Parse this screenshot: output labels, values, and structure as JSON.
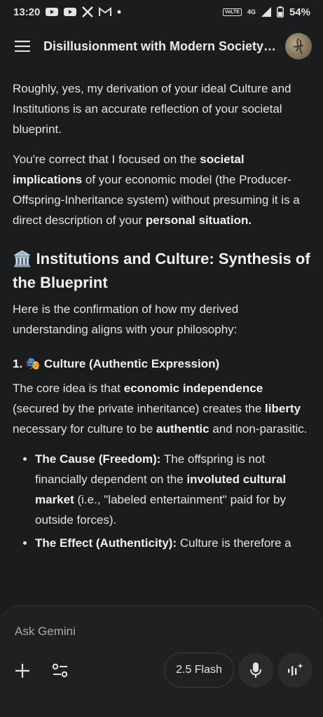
{
  "status_bar": {
    "time": "13:20",
    "volte": "VoLTE",
    "network": "4G",
    "battery": "54%"
  },
  "header": {
    "title": "Disillusionment with Modern Society'..."
  },
  "message": {
    "p1": "Roughly, yes, my derivation of your ideal Culture and Institutions is an accurate reflection of your societal blueprint.",
    "p2_a": "You're correct that I focused on the ",
    "p2_b": "societal implications",
    "p2_c": " of your economic model (the Producer-Offspring-Inheritance system) without presuming it is a direct description of your ",
    "p2_d": "personal situation.",
    "h2_emoji": "🏛️",
    "h2_text": "Institutions and Culture: Synthesis of the Blueprint",
    "p3": "Here is the confirmation of how my derived understanding aligns with your philosophy:",
    "h3_num": "1.",
    "h3_emoji": "🎭",
    "h3_text": "Culture (Authentic Expression)",
    "p4_a": "The core idea is that ",
    "p4_b": "economic independence",
    "p4_c": " (secured by the private inheritance) creates the ",
    "p4_d": "liberty",
    "p4_e": " necessary for culture to be ",
    "p4_f": "authentic",
    "p4_g": " and non-parasitic.",
    "b1_label": "The Cause (Freedom):",
    "b1_a": " The offspring is not financially dependent on the ",
    "b1_b": "involuted cultural market",
    "b1_c": " (i.e., \"labeled entertainment\" paid for by outside forces).",
    "b2_label": "The Effect (Authenticity):",
    "b2_a": " Culture is therefore a"
  },
  "input": {
    "placeholder": "Ask Gemini",
    "model_label": "2.5 Flash"
  }
}
